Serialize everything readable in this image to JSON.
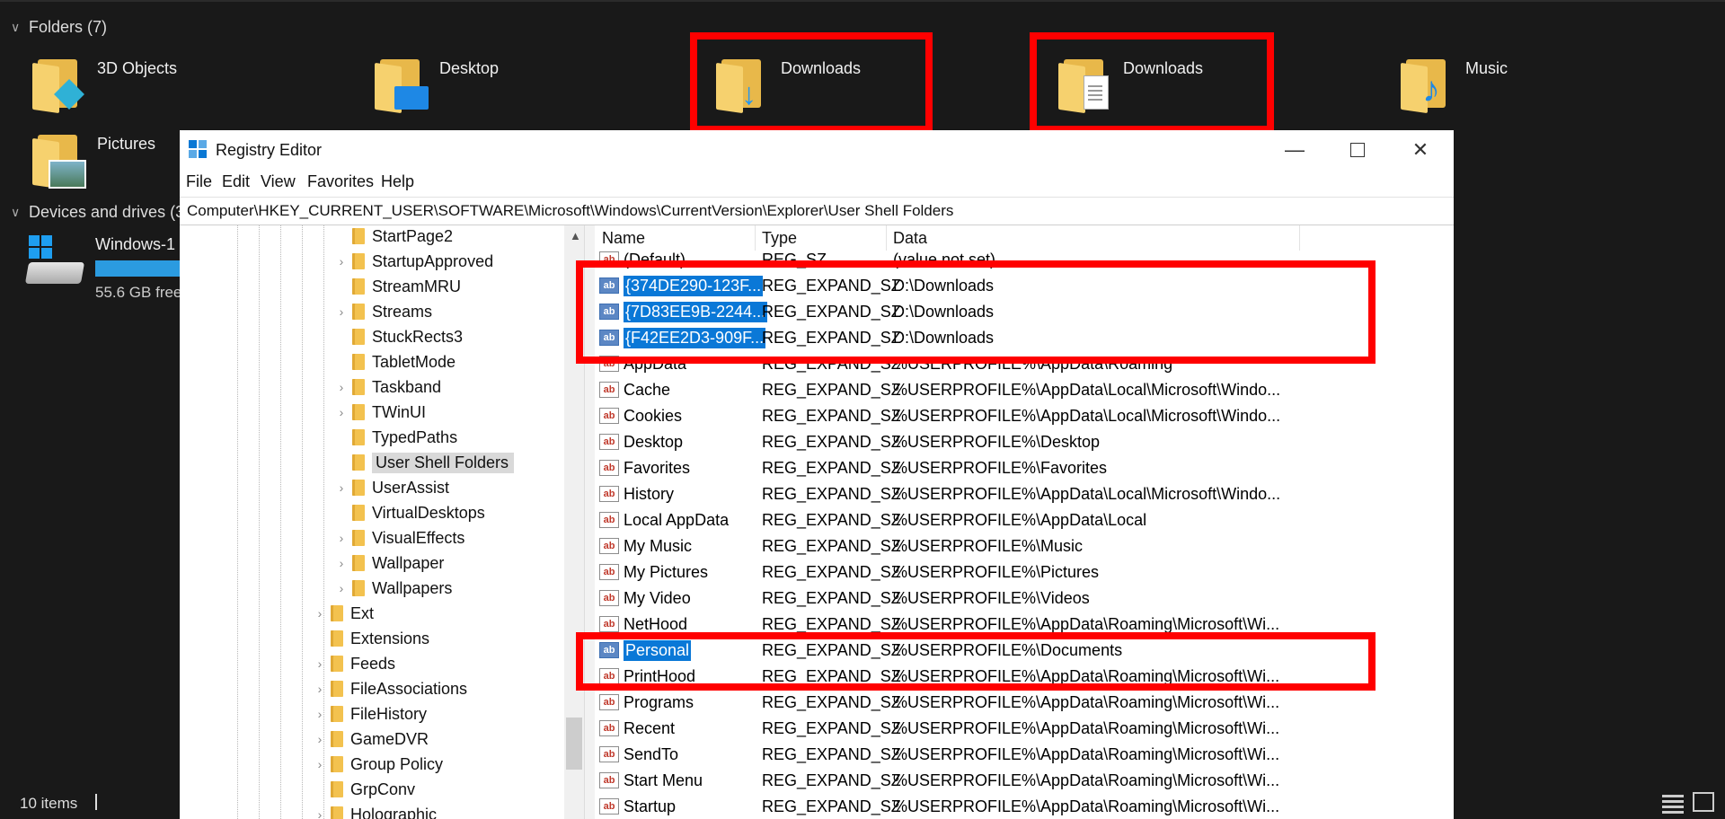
{
  "explorer": {
    "folders_header": "Folders (7)",
    "folders": [
      {
        "label": "3D Objects",
        "icon": "3d-objects-folder-icon"
      },
      {
        "label": "Desktop",
        "icon": "desktop-folder-icon"
      },
      {
        "label": "Downloads",
        "icon": "downloads-folder-icon"
      },
      {
        "label": "Downloads",
        "icon": "documents-folder-icon"
      },
      {
        "label": "Music",
        "icon": "music-folder-icon"
      },
      {
        "label": "Pictures",
        "icon": "pictures-folder-icon"
      }
    ],
    "devices_header": "Devices and drives (3",
    "drive": {
      "name": "Windows-1",
      "free": "55.6 GB free"
    },
    "status": {
      "count": "10 items"
    }
  },
  "regedit": {
    "title": "Registry Editor",
    "menu": [
      "File",
      "Edit",
      "View",
      "Favorites",
      "Help"
    ],
    "address": "Computer\\HKEY_CURRENT_USER\\SOFTWARE\\Microsoft\\Windows\\CurrentVersion\\Explorer\\User Shell Folders",
    "tree": [
      {
        "label": "StartPage2",
        "expandable": false
      },
      {
        "label": "StartupApproved",
        "expandable": true
      },
      {
        "label": "StreamMRU",
        "expandable": false
      },
      {
        "label": "Streams",
        "expandable": true
      },
      {
        "label": "StuckRects3",
        "expandable": false
      },
      {
        "label": "TabletMode",
        "expandable": false
      },
      {
        "label": "Taskband",
        "expandable": true
      },
      {
        "label": "TWinUI",
        "expandable": true
      },
      {
        "label": "TypedPaths",
        "expandable": false
      },
      {
        "label": "User Shell Folders",
        "expandable": false,
        "selected": true
      },
      {
        "label": "UserAssist",
        "expandable": true
      },
      {
        "label": "VirtualDesktops",
        "expandable": false
      },
      {
        "label": "VisualEffects",
        "expandable": true
      },
      {
        "label": "Wallpaper",
        "expandable": true
      },
      {
        "label": "Wallpapers",
        "expandable": true
      },
      {
        "label": "Ext",
        "expandable": true
      },
      {
        "label": "Extensions",
        "expandable": false
      },
      {
        "label": "Feeds",
        "expandable": true
      },
      {
        "label": "FileAssociations",
        "expandable": true
      },
      {
        "label": "FileHistory",
        "expandable": true
      },
      {
        "label": "GameDVR",
        "expandable": true
      },
      {
        "label": "Group Policy",
        "expandable": true
      },
      {
        "label": "GrpConv",
        "expandable": false
      },
      {
        "label": "Holographic",
        "expandable": true
      }
    ],
    "columns": {
      "name": "Name",
      "type": "Type",
      "data": "Data"
    },
    "values": [
      {
        "name": "(Default)",
        "type": "REG_SZ",
        "data": "(value not set)"
      },
      {
        "name": "{374DE290-123F...",
        "type": "REG_EXPAND_SZ",
        "data": "D:\\Downloads",
        "selected": true
      },
      {
        "name": "{7D83EE9B-2244...",
        "type": "REG_EXPAND_SZ",
        "data": "D:\\Downloads",
        "selected": true
      },
      {
        "name": "{F42EE2D3-909F...",
        "type": "REG_EXPAND_SZ",
        "data": "D:\\Downloads",
        "selected": true
      },
      {
        "name": "AppData",
        "type": "REG_EXPAND_SZ",
        "data": "%USERPROFILE%\\AppData\\Roaming"
      },
      {
        "name": "Cache",
        "type": "REG_EXPAND_SZ",
        "data": "%USERPROFILE%\\AppData\\Local\\Microsoft\\Windo..."
      },
      {
        "name": "Cookies",
        "type": "REG_EXPAND_SZ",
        "data": "%USERPROFILE%\\AppData\\Local\\Microsoft\\Windo..."
      },
      {
        "name": "Desktop",
        "type": "REG_EXPAND_SZ",
        "data": "%USERPROFILE%\\Desktop"
      },
      {
        "name": "Favorites",
        "type": "REG_EXPAND_SZ",
        "data": "%USERPROFILE%\\Favorites"
      },
      {
        "name": "History",
        "type": "REG_EXPAND_SZ",
        "data": "%USERPROFILE%\\AppData\\Local\\Microsoft\\Windo..."
      },
      {
        "name": "Local AppData",
        "type": "REG_EXPAND_SZ",
        "data": "%USERPROFILE%\\AppData\\Local"
      },
      {
        "name": "My Music",
        "type": "REG_EXPAND_SZ",
        "data": "%USERPROFILE%\\Music"
      },
      {
        "name": "My Pictures",
        "type": "REG_EXPAND_SZ",
        "data": "%USERPROFILE%\\Pictures"
      },
      {
        "name": "My Video",
        "type": "REG_EXPAND_SZ",
        "data": "%USERPROFILE%\\Videos"
      },
      {
        "name": "NetHood",
        "type": "REG_EXPAND_SZ",
        "data": "%USERPROFILE%\\AppData\\Roaming\\Microsoft\\Wi..."
      },
      {
        "name": "Personal",
        "type": "REG_EXPAND_SZ",
        "data": "%USERPROFILE%\\Documents",
        "selected": true
      },
      {
        "name": "PrintHood",
        "type": "REG_EXPAND_SZ",
        "data": "%USERPROFILE%\\AppData\\Roaming\\Microsoft\\Wi..."
      },
      {
        "name": "Programs",
        "type": "REG_EXPAND_SZ",
        "data": "%USERPROFILE%\\AppData\\Roaming\\Microsoft\\Wi..."
      },
      {
        "name": "Recent",
        "type": "REG_EXPAND_SZ",
        "data": "%USERPROFILE%\\AppData\\Roaming\\Microsoft\\Wi..."
      },
      {
        "name": "SendTo",
        "type": "REG_EXPAND_SZ",
        "data": "%USERPROFILE%\\AppData\\Roaming\\Microsoft\\Wi..."
      },
      {
        "name": "Start Menu",
        "type": "REG_EXPAND_SZ",
        "data": "%USERPROFILE%\\AppData\\Roaming\\Microsoft\\Wi..."
      },
      {
        "name": "Startup",
        "type": "REG_EXPAND_SZ",
        "data": "%USERPROFILE%\\AppData\\Roaming\\Microsoft\\Wi..."
      }
    ]
  },
  "colors": {
    "highlight": "#ff0000",
    "selection": "#0a78d7",
    "folder": "#f3c24f"
  }
}
